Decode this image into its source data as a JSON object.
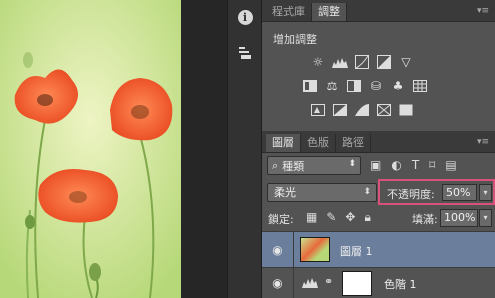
{
  "toolbar": {
    "info_icon_glyph": "i"
  },
  "adjust_panel": {
    "tabs": [
      "程式庫",
      "調整"
    ],
    "active_tab": "調整",
    "title": "增加調整"
  },
  "layers_panel": {
    "tabs": [
      "圖層",
      "色版",
      "路徑"
    ],
    "active_tab": "圖層",
    "filter_kind": "種類",
    "blend_mode": "柔光",
    "opacity_label": "不透明度:",
    "opacity_value": "50%",
    "lock_label": "鎖定:",
    "fill_label": "填滿:",
    "fill_value": "100%",
    "layers": [
      {
        "name": "圖層 1",
        "selected": true,
        "visible": true
      },
      {
        "name": "色階 1",
        "selected": false,
        "visible": true
      }
    ]
  },
  "colors": {
    "accent_highlight": "#d9507a",
    "selection": "#6b7f9c",
    "panel_bg": "#535353"
  }
}
